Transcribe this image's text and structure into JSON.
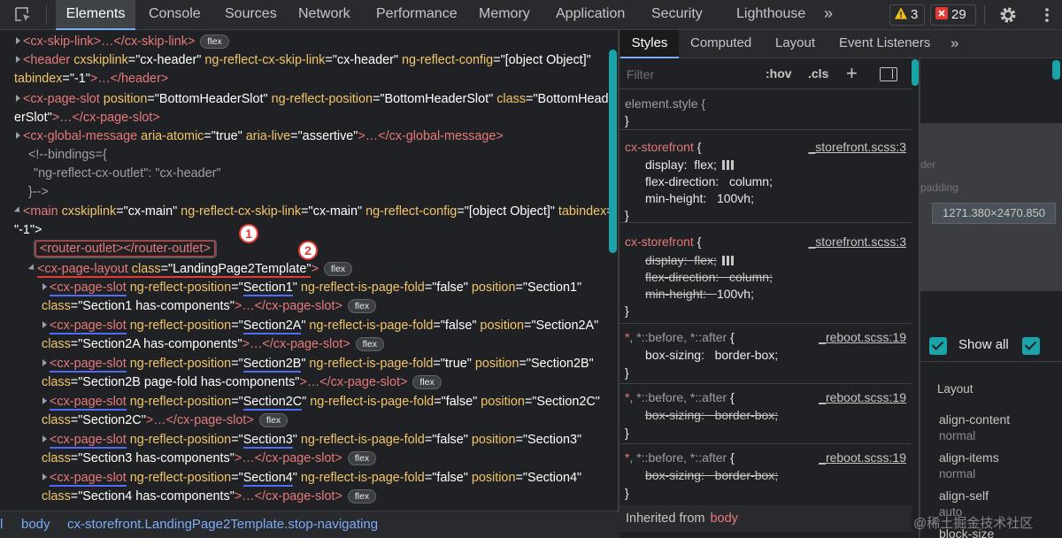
{
  "topbar": {
    "tabs": [
      "Elements",
      "Console",
      "Sources",
      "Network",
      "Performance",
      "Memory",
      "Application",
      "Security",
      "Lighthouse"
    ],
    "more": "»",
    "warnings": "3",
    "errors": "29"
  },
  "tree": {
    "l0": {
      "open": "<cx-skip-link",
      "mid": ">…</",
      "close": "cx-skip-link>",
      "badge": "flex"
    },
    "l1": {
      "tag": "header",
      "a1": " cxskiplink",
      "v1": "=\"cx-header\"",
      "a2": " ng-reflect-cx-skip-link",
      "v2": "=\"cx-header\"",
      "a3": " ng-reflect-config",
      "v3": "=\"[object Object]\""
    },
    "l2": {
      "a": "tabindex",
      "v": "=\"-1\"",
      "mid": ">…</",
      "close": "header>"
    },
    "l3": {
      "tag": "cx-page-slot",
      "a1": " position",
      "v1": "=\"BottomHeaderSlot\"",
      "a2": " ng-reflect-position",
      "v2": "=\"BottomHeaderSlot\"",
      "a3": " class",
      "v3": "=\"BottomHead"
    },
    "l4": {
      "v": "erSlot\"",
      "mid": ">…</",
      "close": "cx-page-slot>"
    },
    "l5": {
      "tag": "cx-global-message",
      "a1": " aria-atomic",
      "v1": "=\"true\"",
      "a2": " aria-live",
      "v2": "=\"assertive\"",
      "mid": ">…</",
      "close": "cx-global-message>"
    },
    "l6": "<!--bindings={",
    "l7": "\"ng-reflect-cx-outlet\": \"cx-header\"",
    "l8": "}-->",
    "l9": {
      "tag": "main",
      "a1": " cxskiplink",
      "v1": "=\"cx-main\"",
      "a2": " ng-reflect-cx-skip-link",
      "v2": "=\"cx-main\"",
      "a3": " ng-reflect-config",
      "v3": "=\"[object Object]\"",
      "a4": " tabindex",
      "v4": "="
    },
    "l10": "\"-1\">",
    "l11": {
      "open": "<router-outlet>",
      "close": "</router-outlet>"
    },
    "l12": {
      "tag": "cx-page-layout",
      "a": " class",
      "v": "=\"LandingPage2Template\"",
      "end": ">",
      "badge": "flex"
    },
    "slots": [
      {
        "tag": "cx-page-slot",
        "a1": " ng-reflect-position",
        "eq": "=\"",
        "pos": "Section1",
        "q": "\"",
        "a2": " ng-reflect-is-page-fold",
        "v2": "=\"false\"",
        "a3": " position",
        "v3": "=\"Section1\"",
        "cls": "class",
        "clsv": "=\"Section1 has-components\"",
        "mid": ">…</",
        "close": "cx-page-slot>",
        "badge": "flex"
      },
      {
        "tag": "cx-page-slot",
        "a1": " ng-reflect-position",
        "eq": "=\"",
        "pos": "Section2A",
        "q": "\"",
        "a2": " ng-reflect-is-page-fold",
        "v2": "=\"false\"",
        "a3": " position",
        "v3": "=\"Section2A\"",
        "cls": "class",
        "clsv": "=\"Section2A has-components\"",
        "mid": ">…</",
        "close": "cx-page-slot>",
        "badge": "flex"
      },
      {
        "tag": "cx-page-slot",
        "a1": " ng-reflect-position",
        "eq": "=\"",
        "pos": "Section2B",
        "q": "\"",
        "a2": " ng-reflect-is-page-fold",
        "v2": "=\"true\"",
        "a3": " position",
        "v3": "=\"Section2B\"",
        "cls": "class",
        "clsv": "=\"Section2B page-fold has-components\"",
        "mid": ">…</",
        "close": "cx-page-slot>",
        "badge": "flex"
      },
      {
        "tag": "cx-page-slot",
        "a1": " ng-reflect-position",
        "eq": "=\"",
        "pos": "Section2C",
        "q": "\"",
        "a2": " ng-reflect-is-page-fold",
        "v2": "=\"false\"",
        "a3": " position",
        "v3": "=\"Section2C\"",
        "cls": "class",
        "clsv": "=\"Section2C\"",
        "mid": ">…</",
        "close": "cx-page-slot>",
        "badge": "flex"
      },
      {
        "tag": "cx-page-slot",
        "a1": " ng-reflect-position",
        "eq": "=\"",
        "pos": "Section3",
        "q": "\"",
        "a2": " ng-reflect-is-page-fold",
        "v2": "=\"false\"",
        "a3": " position",
        "v3": "=\"Section3\"",
        "cls": "class",
        "clsv": "=\"Section3 has-components\"",
        "mid": ">…</",
        "close": "cx-page-slot>",
        "badge": "flex"
      },
      {
        "tag": "cx-page-slot",
        "a1": " ng-reflect-position",
        "eq": "=\"",
        "pos": "Section4",
        "q": "\"",
        "a2": " ng-reflect-is-page-fold",
        "v2": "=\"false\"",
        "a3": " position",
        "v3": "=\"Section4\"",
        "cls": "class",
        "clsv": "=\"Section4 has-components\"",
        "mid": ">…</",
        "close": "cx-page-slot>",
        "badge": "flex"
      }
    ],
    "markers": [
      "1",
      "2"
    ]
  },
  "breadcrumb": [
    "l",
    "body",
    "cx-storefront.LandingPage2Template.stop-navigating"
  ],
  "styles": {
    "tabs": [
      "Styles",
      "Computed",
      "Layout",
      "Event Listeners"
    ],
    "more": "»",
    "filter_placeholder": "Filter",
    "hov": ":hov",
    "cls": ".cls",
    "plus": "+",
    "element_style": "element.style {",
    "close_brace": "}",
    "rule1": {
      "selector": "cx-storefront",
      "open": " {",
      "source": "_storefront.scss:3",
      "props": [
        {
          "name": "display",
          "value": "flex;"
        },
        {
          "name": "flex-direction",
          "value": "column;"
        },
        {
          "name": "min-height",
          "value": "100vh;"
        }
      ]
    },
    "rule2": {
      "selector": "cx-storefront",
      "open": " {",
      "source": "_storefront.scss:3",
      "props": [
        {
          "name": "display",
          "value": "flex;"
        },
        {
          "name": "flex-direction",
          "value": "column;"
        },
        {
          "name": "min-height",
          "value": "100vh;"
        }
      ]
    },
    "rule3": {
      "star": "*",
      "rest": ", *::before, *::after",
      "open": " {",
      "source": "_reboot.scss:19",
      "prop": "box-sizing",
      "value": "border-box;"
    },
    "rule4": {
      "star": "*",
      "rest": ", *::before, *::after",
      "open": " {",
      "source": "_reboot.scss:19",
      "prop": "box-sizing",
      "value": "border-box;"
    },
    "rule5": {
      "star": "*",
      "rest": ", *::before, *::after",
      "open": " {",
      "source": "_reboot.scss:19",
      "prop": "box-sizing",
      "value": "border-box;"
    },
    "inherited_label": "Inherited from",
    "inherited_tag": "body"
  },
  "computed": {
    "box_labels": [
      "der",
      "padding"
    ],
    "box_size": "1271.380×2470.850",
    "show_all": "Show all",
    "section": "Layout",
    "props": [
      {
        "name": "align-content",
        "value": "normal"
      },
      {
        "name": "align-items",
        "value": "normal"
      },
      {
        "name": "align-self",
        "value": "auto"
      },
      {
        "name": "block-size",
        "value": ""
      }
    ]
  },
  "watermark": "@稀土掘金技术社区",
  "colors": {
    "accent": "#7cacf8",
    "teal": "#1aa3a8",
    "tag": "#e67a7a",
    "attr": "#f2c56a",
    "annotation": "#e53935",
    "underline_blue": "#4e6cf5"
  }
}
